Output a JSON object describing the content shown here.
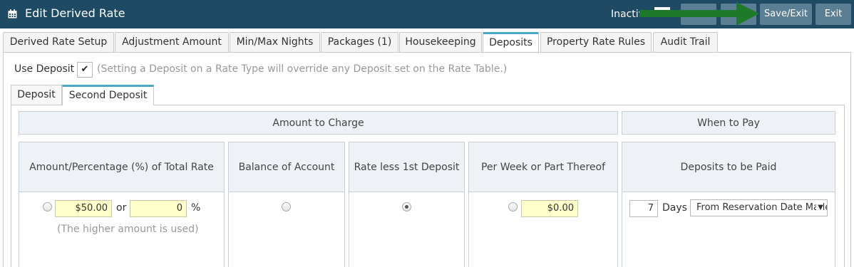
{
  "header": {
    "title": "Edit Derived Rate",
    "icon": "calendar-icon",
    "status_label": "Inactive",
    "save_exit_label": "Save/Exit",
    "exit_label": "Exit"
  },
  "tabs": [
    {
      "label": "Derived Rate Setup"
    },
    {
      "label": "Adjustment Amount"
    },
    {
      "label": "Min/Max Nights"
    },
    {
      "label": "Packages (1)"
    },
    {
      "label": "Housekeeping"
    },
    {
      "label": "Deposits",
      "active": true
    },
    {
      "label": "Property Rate Rules"
    },
    {
      "label": "Audit Trail"
    }
  ],
  "deposit": {
    "use_label": "Use Deposit",
    "use_checked": "✔",
    "note": "(Setting a Deposit on a Rate Type will override any Deposit set on the Rate Table.)"
  },
  "sub_tabs": [
    {
      "label": "Deposit"
    },
    {
      "label": "Second Deposit",
      "active": true
    }
  ],
  "sections": {
    "amount": "Amount to Charge",
    "when": "When to Pay"
  },
  "columns": {
    "amount_pct": "Amount/Percentage (%) of Total Rate",
    "balance": "Balance of Account",
    "rate_less": "Rate less 1st Deposit",
    "per_week": "Per Week or Part Thereof",
    "deposits_paid": "Deposits to be Paid"
  },
  "fields": {
    "amount_value": "$50.00",
    "or_label": "or",
    "percent_value": "0",
    "percent_sign": "%",
    "higher_note": "(The higher amount is used)",
    "per_week_value": "$0.00",
    "days_value": "7",
    "days_label": "Days",
    "from_select": "From Reservation Date Made"
  },
  "colors": {
    "header_bg": "#1f4a63",
    "accent": "#4aa8c4",
    "field_bg": "#ffffcc",
    "arrow": "#1e7a2a"
  }
}
